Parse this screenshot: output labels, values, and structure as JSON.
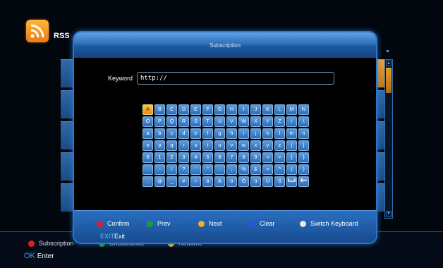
{
  "header": {
    "title": "RSS"
  },
  "bottom_bar": {
    "items": [
      {
        "label": "Subscription",
        "color": "#e02020"
      },
      {
        "label": "Unsubscribe",
        "color": "#18a030"
      },
      {
        "label": "Rename",
        "color": "#f0b020"
      }
    ],
    "ok_key": "OK",
    "ok_label": "Enter"
  },
  "dialog": {
    "title": "Subscription",
    "keyword_label": "Keyword",
    "keyword_value": "http://",
    "selected_key": "A",
    "keyboard": [
      [
        "A",
        "B",
        "C",
        "D",
        "E",
        "F",
        "G",
        "H",
        "I",
        "J",
        "K",
        "L",
        "M",
        "N"
      ],
      [
        "O",
        "P",
        "Q",
        "R",
        "S",
        "T",
        "U",
        "V",
        "W",
        "X",
        "Y",
        "Z",
        "/",
        "\\"
      ],
      [
        "a",
        "b",
        "c",
        "d",
        "e",
        "f",
        "g",
        "h",
        "i",
        "j",
        "k",
        "l",
        "m",
        "n"
      ],
      [
        "o",
        "p",
        "q",
        "r",
        "s",
        "t",
        "u",
        "v",
        "w",
        "x",
        "y",
        "z",
        "[",
        "]"
      ],
      [
        "0",
        "1",
        "2",
        "3",
        "4",
        "5",
        "6",
        "7",
        "8",
        "9",
        "<",
        ">",
        "{",
        "}"
      ],
      [
        ".",
        "-",
        "!",
        "?",
        "'",
        "\"",
        ":",
        ";",
        "%",
        "&",
        "=",
        "^",
        "(",
        ")"
      ],
      [
        ",",
        "@",
        "_",
        "#",
        "+",
        "ä",
        "Ä",
        "ö",
        "Ö",
        "ü",
        "Ü",
        "ß",
        "space-icon",
        "backspace-icon"
      ]
    ],
    "hints": [
      {
        "label": "Confirm",
        "color": "#e02020"
      },
      {
        "label": "Prev",
        "color": "#18a030"
      },
      {
        "label": "Next",
        "color": "#f0b020"
      },
      {
        "label": "Clear",
        "color": "#3050e0"
      },
      {
        "label": "Switch Keyboard",
        "color": "#e8e8e8"
      }
    ],
    "exit_key": "EXIT",
    "exit_label": "Exit"
  },
  "scrollbar": {
    "up": "▴",
    "down": "▾"
  }
}
